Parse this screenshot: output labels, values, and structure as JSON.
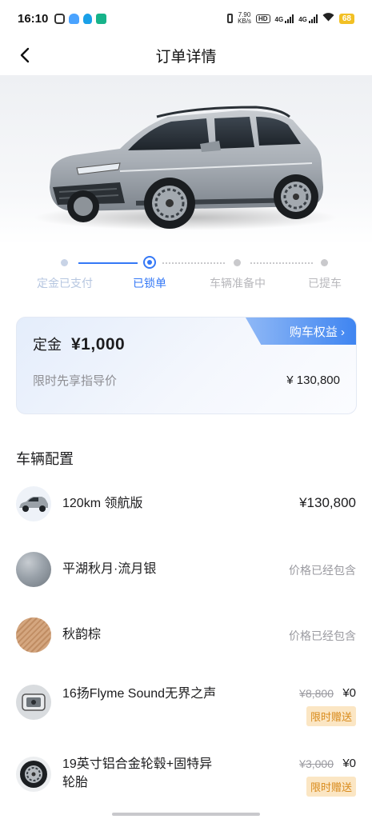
{
  "status_bar": {
    "time": "16:10",
    "net_speed_value": "7.90",
    "net_speed_unit": "KB/s",
    "hd_label": "HD",
    "sim1_label": "4G",
    "sim2_label": "4G",
    "battery": "68"
  },
  "header": {
    "title": "订单详情"
  },
  "progress": {
    "steps": [
      {
        "label": "定金已支付",
        "state": "done"
      },
      {
        "label": "已锁单",
        "state": "active"
      },
      {
        "label": "车辆准备中",
        "state": "todo"
      },
      {
        "label": "已提车",
        "state": "todo"
      }
    ]
  },
  "deposit_card": {
    "deposit_label": "定金",
    "deposit_amount": "¥1,000",
    "benefits_label": "购车权益 ›",
    "guide_label": "限时先享指导价",
    "guide_price": "¥ 130,800"
  },
  "config": {
    "section_title": "车辆配置",
    "items": [
      {
        "name": "120km 领航版",
        "price": "¥130,800"
      },
      {
        "name": "平湖秋月·流月银",
        "price_note": "价格已经包含"
      },
      {
        "name": "秋韵棕",
        "price_note": "价格已经包含"
      },
      {
        "name": "16扬Flyme Sound无界之声",
        "original_price": "¥8,800",
        "price": "¥0",
        "badge": "限时赠送"
      },
      {
        "name": "19英寸铝合金轮毂+固特异轮胎",
        "original_price": "¥3,000",
        "price": "¥0",
        "badge": "限时赠送"
      }
    ]
  },
  "colors": {
    "accent": "#3478f6",
    "muted_blue": "#b6c6e0",
    "gift_text": "#d98b1c",
    "gift_bg": "#fbe6c4",
    "silver": "#9aa3ab",
    "brown": "#c99a73"
  },
  "icons": {
    "back": "chevron-left-icon",
    "car_hero": "car-image",
    "wifi": "wifi-icon"
  }
}
